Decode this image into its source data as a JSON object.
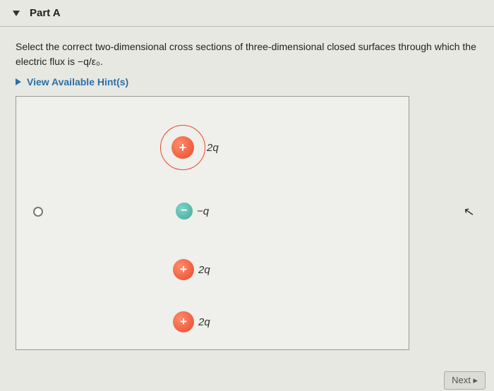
{
  "header": {
    "part_label": "Part A"
  },
  "question": {
    "line1": "Select the correct two-dimensional cross sections of three-dimensional closed surfaces through which the",
    "line2_prefix": "electric flux is ",
    "line2_expr": "−q/ε₀",
    "line2_suffix": "."
  },
  "hints": {
    "label": "View Available Hint(s)"
  },
  "charges": [
    {
      "sign": "+",
      "label": "2q",
      "has_ring": true
    },
    {
      "sign": "−",
      "label": "−q",
      "has_ring": false
    },
    {
      "sign": "+",
      "label": "2q",
      "has_ring": false
    },
    {
      "sign": "+",
      "label": "2q",
      "has_ring": false
    }
  ],
  "nav": {
    "next": "Next ▸"
  }
}
